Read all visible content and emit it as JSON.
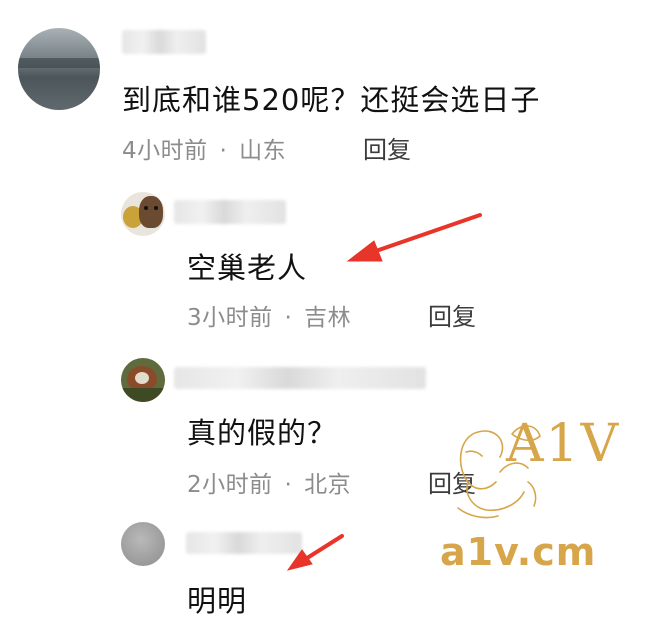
{
  "comments": [
    {
      "text": "到底和谁520呢？还挺会选日子",
      "time": "4小时前",
      "location": "山东",
      "reply_label": "回复"
    },
    {
      "text": "空巢老人",
      "time": "3小时前",
      "location": "吉林",
      "reply_label": "回复"
    },
    {
      "text": "真的假的？",
      "time": "2小时前",
      "location": "北京",
      "reply_label": "回复"
    },
    {
      "text": "明明"
    }
  ],
  "separator": "·",
  "watermark": {
    "logo": "A1V",
    "domain": "a1v.cm"
  },
  "colors": {
    "arrow": "#e8352a",
    "meta_text": "#8c8c8c",
    "watermark": "#d7a64a"
  }
}
